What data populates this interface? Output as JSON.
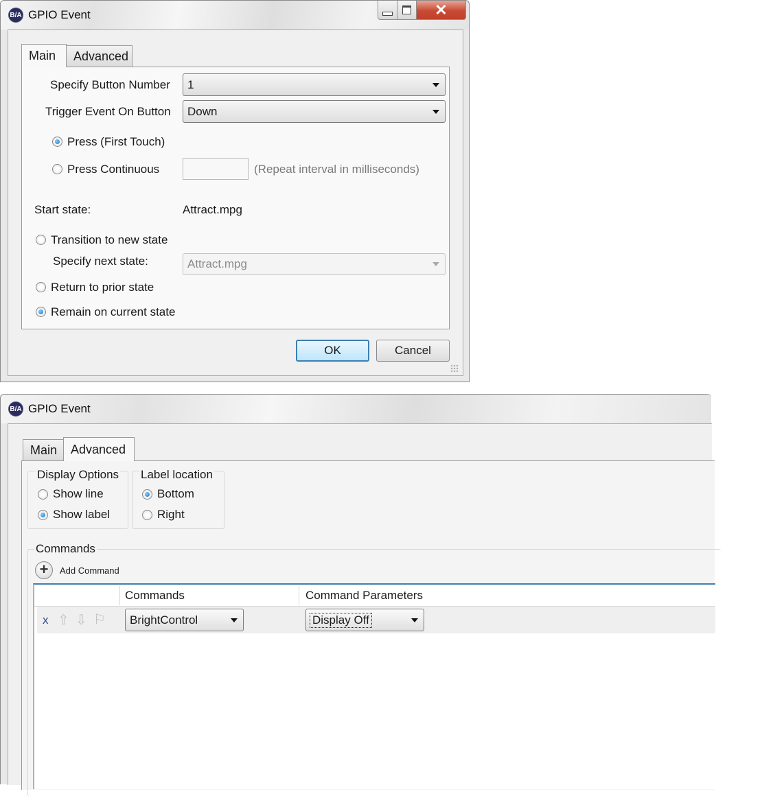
{
  "window1": {
    "title": "GPIO Event",
    "app_icon_text": "B/A",
    "tabs": [
      {
        "label": "Main"
      },
      {
        "label": "Advanced"
      }
    ],
    "specify_button_label": "Specify Button Number",
    "specify_button_value": "1",
    "trigger_event_label": "Trigger Event On Button",
    "trigger_event_value": "Down",
    "press_first_label": "Press (First Touch)",
    "press_first_selected": true,
    "press_continuous_label": "Press Continuous",
    "press_continuous_selected": false,
    "repeat_interval_value": "",
    "repeat_interval_hint": "(Repeat interval in milliseconds)",
    "start_state_label": "Start state:",
    "start_state_value": "Attract.mpg",
    "transition_label": "Transition to new state",
    "specify_next_label": "Specify next state:",
    "next_state_value": "Attract.mpg",
    "return_prior_label": "Return to prior state",
    "remain_current_label": "Remain on current state",
    "ok_label": "OK",
    "cancel_label": "Cancel",
    "close_glyph": "✕"
  },
  "window2": {
    "title": "GPIO Event",
    "app_icon_text": "B/A",
    "tabs": [
      {
        "label": "Main"
      },
      {
        "label": "Advanced"
      }
    ],
    "display_options": {
      "title": "Display Options",
      "show_line_label": "Show line",
      "show_line_selected": false,
      "show_label_label": "Show label",
      "show_label_selected": true
    },
    "label_location": {
      "title": "Label location",
      "bottom_label": "Bottom",
      "bottom_selected": true,
      "right_label": "Right",
      "right_selected": false
    },
    "commands": {
      "title": "Commands",
      "add_label": "Add Command",
      "add_glyph": "+",
      "columns": [
        "Commands",
        "Command Parameters"
      ],
      "rows": [
        {
          "delete_glyph": "x",
          "command": "BrightControl",
          "parameter": "Display Off"
        }
      ]
    }
  }
}
